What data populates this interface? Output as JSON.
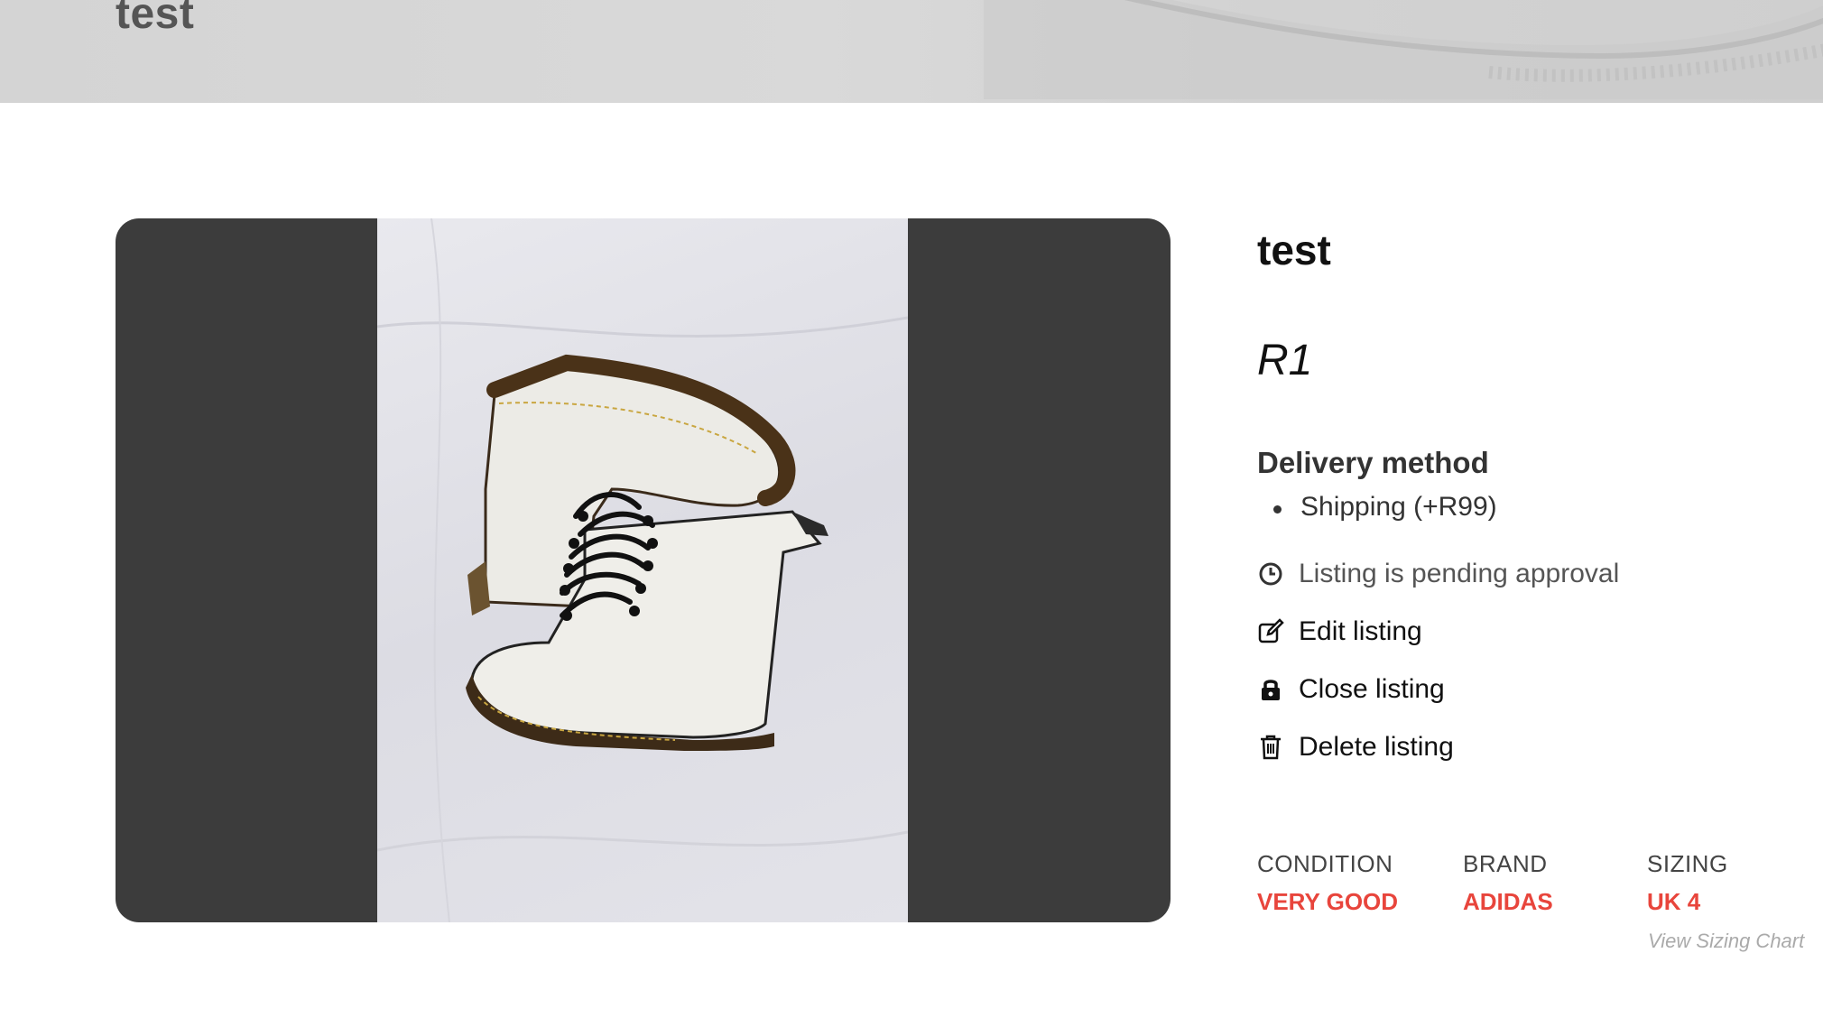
{
  "header": {
    "title": "test"
  },
  "listing": {
    "title": "test",
    "price": "R1",
    "delivery": {
      "heading": "Delivery method",
      "methods": [
        "Shipping (+R99)"
      ]
    },
    "status": {
      "icon": "clock-icon",
      "text": "Listing is pending approval"
    },
    "actions": {
      "edit": {
        "label": "Edit listing",
        "icon": "edit-icon"
      },
      "close": {
        "label": "Close listing",
        "icon": "lock-icon"
      },
      "delete": {
        "label": "Delete listing",
        "icon": "trash-icon"
      }
    },
    "attributes": {
      "condition": {
        "label": "CONDITION",
        "value": "VERY GOOD"
      },
      "brand": {
        "label": "BRAND",
        "value": "ADIDAS"
      },
      "sizing": {
        "label": "SIZING",
        "value": "UK 4",
        "link": "View Sizing Chart"
      }
    }
  },
  "colors": {
    "accent": "#e8453c",
    "gallery_bg": "#3c3c3c",
    "header_bg": "#d6d6d6"
  }
}
